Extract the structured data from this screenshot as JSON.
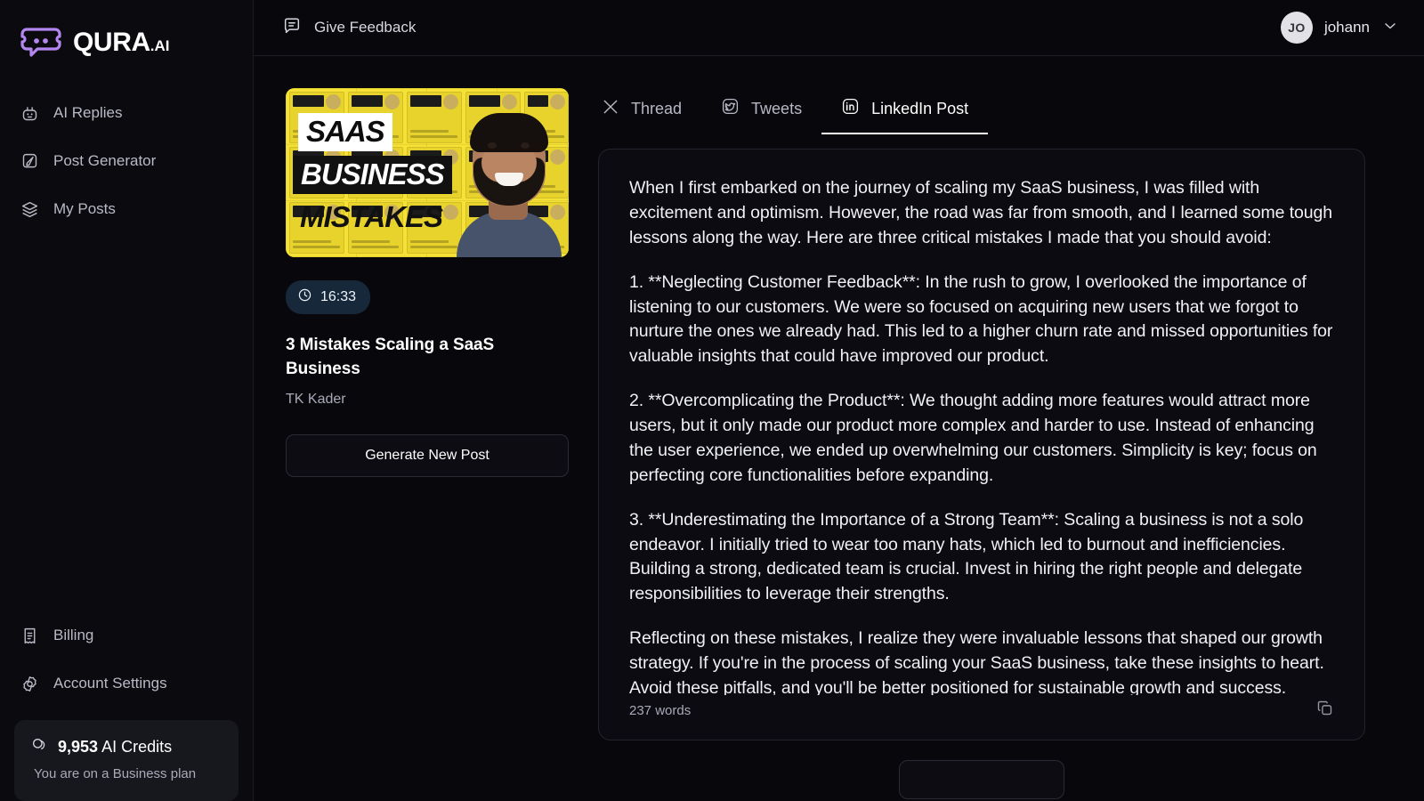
{
  "brand": {
    "name": "QURA",
    "suffix": ".AI",
    "logo_color": "#b487f0"
  },
  "sidebar": {
    "items": [
      {
        "label": "AI Replies",
        "icon": "robot-icon"
      },
      {
        "label": "Post Generator",
        "icon": "feather-pen-icon"
      },
      {
        "label": "My Posts",
        "icon": "layers-icon"
      }
    ],
    "bottom_items": [
      {
        "label": "Billing",
        "icon": "receipt-icon"
      },
      {
        "label": "Account Settings",
        "icon": "gear-icon"
      }
    ],
    "credits": {
      "amount": "9,953",
      "unit": "AI Credits",
      "plan_text": "You are on a Business plan"
    }
  },
  "topbar": {
    "feedback_label": "Give Feedback",
    "user": {
      "initials": "JO",
      "name": "johann"
    }
  },
  "video": {
    "duration": "16:33",
    "title": "3 Mistakes Scaling a SaaS Business",
    "author": "TK Kader",
    "generate_label": "Generate New Post",
    "thumbnail": {
      "line1": "SAAS",
      "line2": "BUSINESS",
      "line3": "MISTAKES",
      "bg_color": "#f5e234"
    }
  },
  "tabs": [
    {
      "label": "Thread",
      "icon": "x-twitter-icon",
      "active": false
    },
    {
      "label": "Tweets",
      "icon": "twitter-bird-icon",
      "active": false
    },
    {
      "label": "LinkedIn Post",
      "icon": "linkedin-icon",
      "active": true
    }
  ],
  "post": {
    "paragraphs": [
      "When I first embarked on the journey of scaling my SaaS business, I was filled with excitement and optimism. However, the road was far from smooth, and I learned some tough lessons along the way. Here are three critical mistakes I made that you should avoid:",
      "1. **Neglecting Customer Feedback**: In the rush to grow, I overlooked the importance of listening to our customers. We were so focused on acquiring new users that we forgot to nurture the ones we already had. This led to a higher churn rate and missed opportunities for valuable insights that could have improved our product.",
      "2. **Overcomplicating the Product**: We thought adding more features would attract more users, but it only made our product more complex and harder to use. Instead of enhancing the user experience, we ended up overwhelming our customers. Simplicity is key; focus on perfecting core functionalities before expanding.",
      "3. **Underestimating the Importance of a Strong Team**: Scaling a business is not a solo endeavor. I initially tried to wear too many hats, which led to burnout and inefficiencies. Building a strong, dedicated team is crucial. Invest in hiring the right people and delegate responsibilities to leverage their strengths.",
      "Reflecting on these mistakes, I realize they were invaluable lessons that shaped our growth strategy. If you're in the process of scaling your SaaS business, take these insights to heart. Avoid these pitfalls, and you'll be better positioned for sustainable growth and success."
    ],
    "word_count": "237 words"
  }
}
